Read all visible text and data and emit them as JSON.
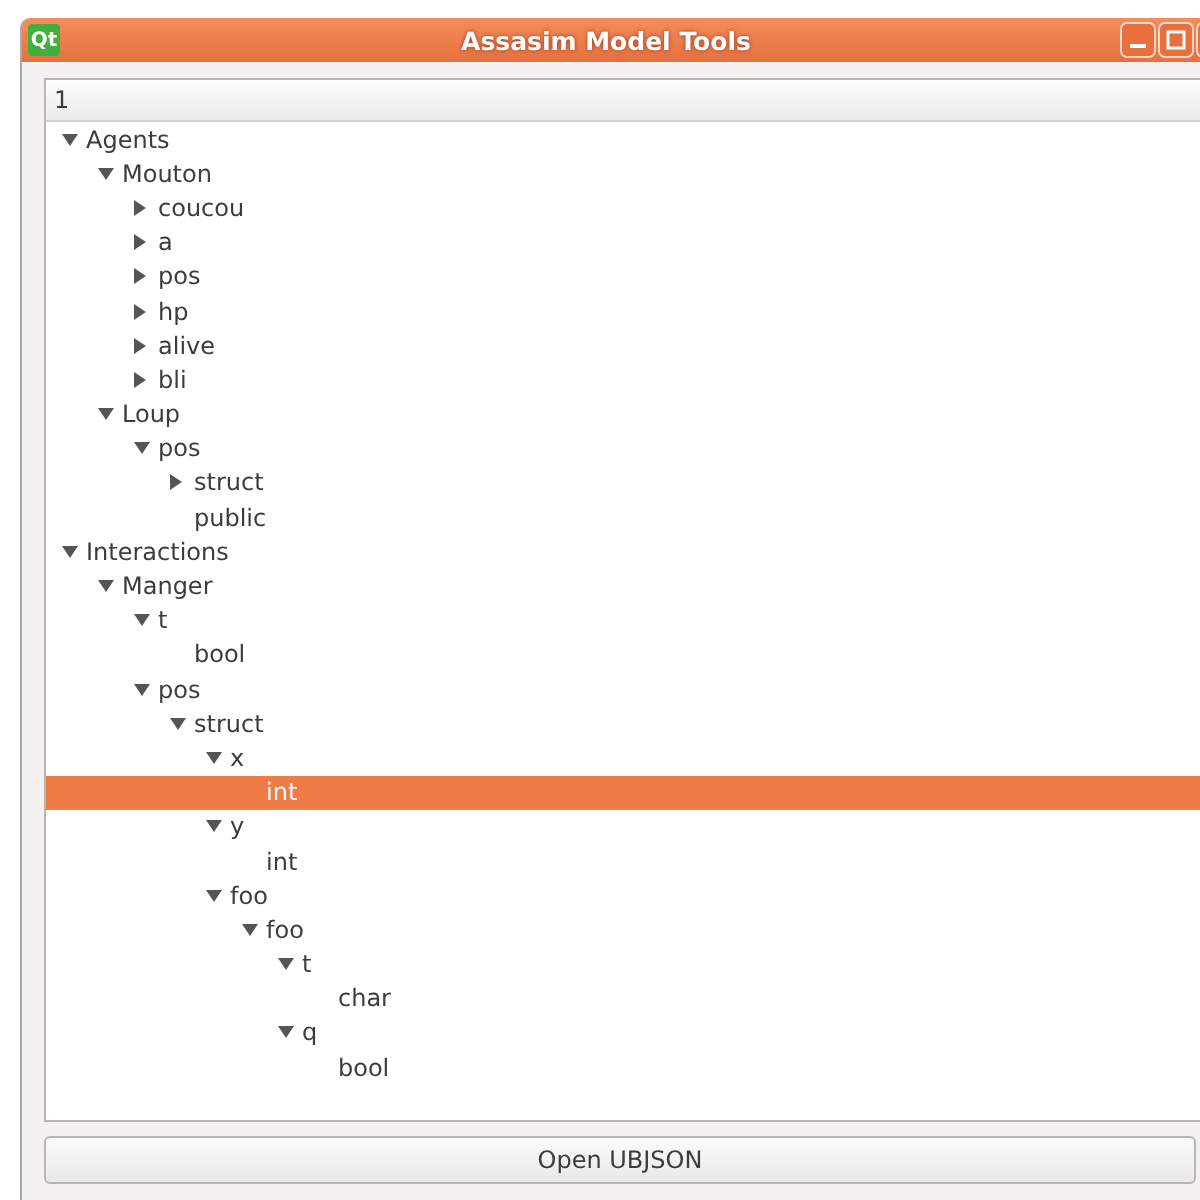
{
  "window": {
    "title": "Assasim Model Tools",
    "app_icon": "Qt"
  },
  "tree": {
    "header": "1",
    "items": [
      {
        "label": "Agents",
        "expanded": true,
        "selected": false,
        "children": [
          {
            "label": "Mouton",
            "expanded": true,
            "selected": false,
            "children": [
              {
                "label": "coucou",
                "expanded": false,
                "selected": false
              },
              {
                "label": "a",
                "expanded": false,
                "selected": false
              },
              {
                "label": "pos",
                "expanded": false,
                "selected": false
              },
              {
                "label": "hp",
                "expanded": false,
                "selected": false
              },
              {
                "label": "alive",
                "expanded": false,
                "selected": false
              },
              {
                "label": "bli",
                "expanded": false,
                "selected": false
              }
            ]
          },
          {
            "label": "Loup",
            "expanded": true,
            "selected": false,
            "children": [
              {
                "label": "pos",
                "expanded": true,
                "selected": false,
                "children": [
                  {
                    "label": "struct",
                    "expanded": false,
                    "selected": false
                  },
                  {
                    "label": "public",
                    "selected": false
                  }
                ]
              }
            ]
          }
        ]
      },
      {
        "label": "Interactions",
        "expanded": true,
        "selected": false,
        "children": [
          {
            "label": "Manger",
            "expanded": true,
            "selected": false,
            "children": [
              {
                "label": "t",
                "expanded": true,
                "selected": false,
                "children": [
                  {
                    "label": "bool",
                    "selected": false
                  }
                ]
              },
              {
                "label": "pos",
                "expanded": true,
                "selected": false,
                "children": [
                  {
                    "label": "struct",
                    "expanded": true,
                    "selected": false,
                    "children": [
                      {
                        "label": "x",
                        "expanded": true,
                        "selected": false,
                        "children": [
                          {
                            "label": "int",
                            "selected": true
                          }
                        ]
                      },
                      {
                        "label": "y",
                        "expanded": true,
                        "selected": false,
                        "children": [
                          {
                            "label": "int",
                            "selected": false
                          }
                        ]
                      },
                      {
                        "label": "foo",
                        "expanded": true,
                        "selected": false,
                        "children": [
                          {
                            "label": "foo",
                            "expanded": true,
                            "selected": false,
                            "children": [
                              {
                                "label": "t",
                                "expanded": true,
                                "selected": false,
                                "children": [
                                  {
                                    "label": "char",
                                    "selected": false
                                  }
                                ]
                              },
                              {
                                "label": "q",
                                "expanded": true,
                                "selected": false,
                                "children": [
                                  {
                                    "label": "bool",
                                    "selected": false
                                  }
                                ]
                              }
                            ]
                          }
                        ]
                      }
                    ]
                  }
                ]
              }
            ]
          }
        ]
      }
    ]
  },
  "buttons": [
    {
      "label": "Open UBJSON"
    }
  ]
}
